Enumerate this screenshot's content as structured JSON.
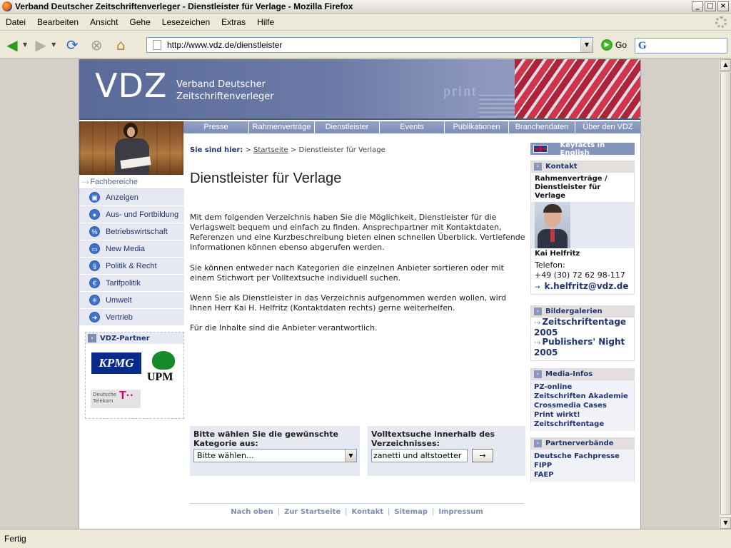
{
  "window": {
    "title": "Verband Deutscher Zeitschriftenverleger - Dienstleister für Verlage - Mozilla Firefox",
    "buttons": [
      "_",
      "□",
      "×"
    ]
  },
  "menu": [
    "Datei",
    "Bearbeiten",
    "Ansicht",
    "Gehe",
    "Lesezeichen",
    "Extras",
    "Hilfe"
  ],
  "toolbar": {
    "url": "http://www.vdz.de/dienstleister",
    "go_label": "Go"
  },
  "status": "Fertig",
  "banner": {
    "logo": "VDZ",
    "subtitle_line1": "Verband Deutscher",
    "subtitle_line2": "Zeitschriftenverleger",
    "print_word": "print"
  },
  "topnav": [
    "Presse",
    "Rahmenverträge",
    "Dienstleister",
    "Events",
    "Publikationen",
    "Branchendaten",
    "Über den VDZ"
  ],
  "leftnav": {
    "section": "Fachbereiche",
    "items": [
      {
        "label": "Anzeigen",
        "icon": "▣"
      },
      {
        "label": "Aus- und Fortbildung",
        "icon": "●"
      },
      {
        "label": "Betriebswirtschaft",
        "icon": "%"
      },
      {
        "label": "New Media",
        "icon": "▭"
      },
      {
        "label": "Politik & Recht",
        "icon": "§"
      },
      {
        "label": "Tarifpolitik",
        "icon": "€"
      },
      {
        "label": "Umwelt",
        "icon": "✳"
      },
      {
        "label": "Vertrieb",
        "icon": "➜"
      }
    ]
  },
  "partner": {
    "head": "VDZ-Partner",
    "kpmg": "KPMG",
    "upm": "UPM",
    "telekom_line1": "Deutsche",
    "telekom_line2": "Telekom",
    "telekom_mark": "T··"
  },
  "main": {
    "breadcrumb_lead": "Sie sind hier:",
    "breadcrumb_sep1": " > ",
    "breadcrumb_home": "Startseite",
    "breadcrumb_sep2": " > ",
    "breadcrumb_current": "Dienstleister für Verlage",
    "title": "Dienstleister für Verlage",
    "para1": "Mit dem folgenden Verzeichnis haben Sie die Möglichkeit, Dienstleister für die Verlagswelt bequem und einfach zu finden. Ansprechpartner mit Kontaktdaten, Referenzen und eine Kurzbeschreibung bieten einen schnellen Überblick. Vertiefende Informationen können ebenso abgerufen werden.",
    "para2": "Sie können entweder nach Kategorien die einzelnen Anbieter sortieren oder mit einem Stichwort per Volltextsuche individuell suchen.",
    "para3": "Wenn Sie als Dienstleister in das Verzeichnis aufgenommen werden wollen, wird Ihnen Herr Kai H. Helfritz (Kontaktdaten rechts) gerne weiterhelfen.",
    "para4": "Für die Inhalte sind die Anbieter verantwortlich.",
    "category_label": "Bitte wählen Sie die gewünschte Kategorie aus:",
    "category_value": "Bitte wählen...",
    "search_label": "Volltextsuche innerhalb des Verzeichnisses:",
    "search_value": "zanetti und altstoetter",
    "search_button": "→"
  },
  "footer": [
    "Nach oben",
    "Zur Startseite",
    "Kontakt",
    "Sitemap",
    "Impressum"
  ],
  "right": {
    "keyfacts": "Keyfacts in English",
    "kontakt_head": "Kontakt",
    "kontakt_topic": "Rahmenverträge / Dienstleister für Verlage",
    "person_name": "Kai Helfritz",
    "phone_label": "Telefon:",
    "phone": "+49 (30) 72 62 98-117",
    "email": "k.helfritz@vdz.de",
    "galerie_head": "Bildergalerien",
    "galerien": [
      "Zeitschriftentage 2005",
      "Publishers' Night 2005"
    ],
    "media_head": "Media-Infos",
    "media": [
      "PZ-online",
      "Zeitschriften Akademie",
      "Crossmedia Cases",
      "Print wirkt!",
      "Zeitschriftentage"
    ],
    "partner_head": "Partnerverbände",
    "partnerverbaende": [
      "Deutsche Fachpresse",
      "FIPP",
      "FAEP"
    ]
  }
}
